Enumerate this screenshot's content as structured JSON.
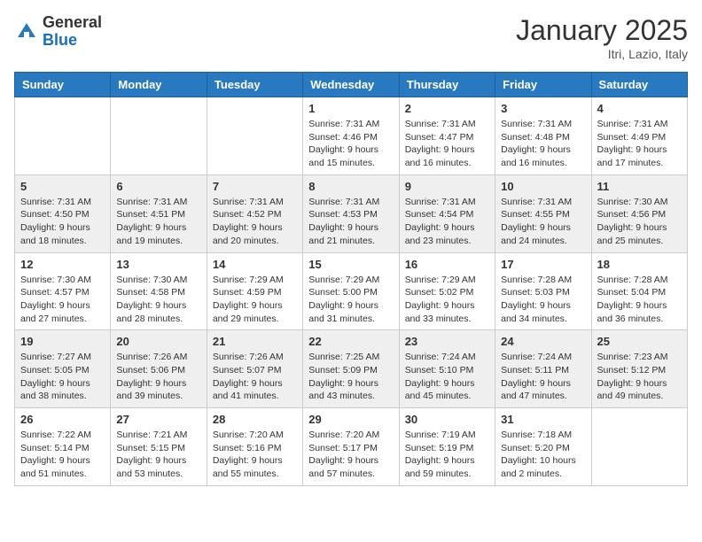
{
  "header": {
    "logo_general": "General",
    "logo_blue": "Blue",
    "month": "January 2025",
    "location": "Itri, Lazio, Italy"
  },
  "weekdays": [
    "Sunday",
    "Monday",
    "Tuesday",
    "Wednesday",
    "Thursday",
    "Friday",
    "Saturday"
  ],
  "weeks": [
    [
      {
        "day": "",
        "sunrise": "",
        "sunset": "",
        "daylight": ""
      },
      {
        "day": "",
        "sunrise": "",
        "sunset": "",
        "daylight": ""
      },
      {
        "day": "",
        "sunrise": "",
        "sunset": "",
        "daylight": ""
      },
      {
        "day": "1",
        "sunrise": "Sunrise: 7:31 AM",
        "sunset": "Sunset: 4:46 PM",
        "daylight": "Daylight: 9 hours and 15 minutes."
      },
      {
        "day": "2",
        "sunrise": "Sunrise: 7:31 AM",
        "sunset": "Sunset: 4:47 PM",
        "daylight": "Daylight: 9 hours and 16 minutes."
      },
      {
        "day": "3",
        "sunrise": "Sunrise: 7:31 AM",
        "sunset": "Sunset: 4:48 PM",
        "daylight": "Daylight: 9 hours and 16 minutes."
      },
      {
        "day": "4",
        "sunrise": "Sunrise: 7:31 AM",
        "sunset": "Sunset: 4:49 PM",
        "daylight": "Daylight: 9 hours and 17 minutes."
      }
    ],
    [
      {
        "day": "5",
        "sunrise": "Sunrise: 7:31 AM",
        "sunset": "Sunset: 4:50 PM",
        "daylight": "Daylight: 9 hours and 18 minutes."
      },
      {
        "day": "6",
        "sunrise": "Sunrise: 7:31 AM",
        "sunset": "Sunset: 4:51 PM",
        "daylight": "Daylight: 9 hours and 19 minutes."
      },
      {
        "day": "7",
        "sunrise": "Sunrise: 7:31 AM",
        "sunset": "Sunset: 4:52 PM",
        "daylight": "Daylight: 9 hours and 20 minutes."
      },
      {
        "day": "8",
        "sunrise": "Sunrise: 7:31 AM",
        "sunset": "Sunset: 4:53 PM",
        "daylight": "Daylight: 9 hours and 21 minutes."
      },
      {
        "day": "9",
        "sunrise": "Sunrise: 7:31 AM",
        "sunset": "Sunset: 4:54 PM",
        "daylight": "Daylight: 9 hours and 23 minutes."
      },
      {
        "day": "10",
        "sunrise": "Sunrise: 7:31 AM",
        "sunset": "Sunset: 4:55 PM",
        "daylight": "Daylight: 9 hours and 24 minutes."
      },
      {
        "day": "11",
        "sunrise": "Sunrise: 7:30 AM",
        "sunset": "Sunset: 4:56 PM",
        "daylight": "Daylight: 9 hours and 25 minutes."
      }
    ],
    [
      {
        "day": "12",
        "sunrise": "Sunrise: 7:30 AM",
        "sunset": "Sunset: 4:57 PM",
        "daylight": "Daylight: 9 hours and 27 minutes."
      },
      {
        "day": "13",
        "sunrise": "Sunrise: 7:30 AM",
        "sunset": "Sunset: 4:58 PM",
        "daylight": "Daylight: 9 hours and 28 minutes."
      },
      {
        "day": "14",
        "sunrise": "Sunrise: 7:29 AM",
        "sunset": "Sunset: 4:59 PM",
        "daylight": "Daylight: 9 hours and 29 minutes."
      },
      {
        "day": "15",
        "sunrise": "Sunrise: 7:29 AM",
        "sunset": "Sunset: 5:00 PM",
        "daylight": "Daylight: 9 hours and 31 minutes."
      },
      {
        "day": "16",
        "sunrise": "Sunrise: 7:29 AM",
        "sunset": "Sunset: 5:02 PM",
        "daylight": "Daylight: 9 hours and 33 minutes."
      },
      {
        "day": "17",
        "sunrise": "Sunrise: 7:28 AM",
        "sunset": "Sunset: 5:03 PM",
        "daylight": "Daylight: 9 hours and 34 minutes."
      },
      {
        "day": "18",
        "sunrise": "Sunrise: 7:28 AM",
        "sunset": "Sunset: 5:04 PM",
        "daylight": "Daylight: 9 hours and 36 minutes."
      }
    ],
    [
      {
        "day": "19",
        "sunrise": "Sunrise: 7:27 AM",
        "sunset": "Sunset: 5:05 PM",
        "daylight": "Daylight: 9 hours and 38 minutes."
      },
      {
        "day": "20",
        "sunrise": "Sunrise: 7:26 AM",
        "sunset": "Sunset: 5:06 PM",
        "daylight": "Daylight: 9 hours and 39 minutes."
      },
      {
        "day": "21",
        "sunrise": "Sunrise: 7:26 AM",
        "sunset": "Sunset: 5:07 PM",
        "daylight": "Daylight: 9 hours and 41 minutes."
      },
      {
        "day": "22",
        "sunrise": "Sunrise: 7:25 AM",
        "sunset": "Sunset: 5:09 PM",
        "daylight": "Daylight: 9 hours and 43 minutes."
      },
      {
        "day": "23",
        "sunrise": "Sunrise: 7:24 AM",
        "sunset": "Sunset: 5:10 PM",
        "daylight": "Daylight: 9 hours and 45 minutes."
      },
      {
        "day": "24",
        "sunrise": "Sunrise: 7:24 AM",
        "sunset": "Sunset: 5:11 PM",
        "daylight": "Daylight: 9 hours and 47 minutes."
      },
      {
        "day": "25",
        "sunrise": "Sunrise: 7:23 AM",
        "sunset": "Sunset: 5:12 PM",
        "daylight": "Daylight: 9 hours and 49 minutes."
      }
    ],
    [
      {
        "day": "26",
        "sunrise": "Sunrise: 7:22 AM",
        "sunset": "Sunset: 5:14 PM",
        "daylight": "Daylight: 9 hours and 51 minutes."
      },
      {
        "day": "27",
        "sunrise": "Sunrise: 7:21 AM",
        "sunset": "Sunset: 5:15 PM",
        "daylight": "Daylight: 9 hours and 53 minutes."
      },
      {
        "day": "28",
        "sunrise": "Sunrise: 7:20 AM",
        "sunset": "Sunset: 5:16 PM",
        "daylight": "Daylight: 9 hours and 55 minutes."
      },
      {
        "day": "29",
        "sunrise": "Sunrise: 7:20 AM",
        "sunset": "Sunset: 5:17 PM",
        "daylight": "Daylight: 9 hours and 57 minutes."
      },
      {
        "day": "30",
        "sunrise": "Sunrise: 7:19 AM",
        "sunset": "Sunset: 5:19 PM",
        "daylight": "Daylight: 9 hours and 59 minutes."
      },
      {
        "day": "31",
        "sunrise": "Sunrise: 7:18 AM",
        "sunset": "Sunset: 5:20 PM",
        "daylight": "Daylight: 10 hours and 2 minutes."
      },
      {
        "day": "",
        "sunrise": "",
        "sunset": "",
        "daylight": ""
      }
    ]
  ]
}
